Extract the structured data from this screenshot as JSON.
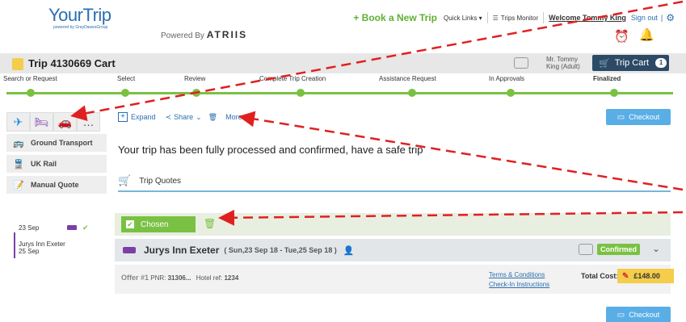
{
  "header": {
    "logo_main": "YourTrip",
    "logo_sub": "powered by GrayDawesGroup",
    "powered_by": "Powered By",
    "powered_brand": "ATRIIS",
    "book_new": "+ Book a New Trip",
    "quick_links": "Quick Links ▾",
    "trips_monitor": "Trips Monitor",
    "welcome": "Welcome Tommy King",
    "sign_out": "Sign out",
    "sep": "|"
  },
  "trip_bar": {
    "title": "Trip 4130669 Cart",
    "traveller_line1": "Mr. Tommy",
    "traveller_line2": "King (Adult)",
    "cart_label": "Trip Cart",
    "cart_count": "1"
  },
  "steps": [
    {
      "label": "Search or Request"
    },
    {
      "label": "Select"
    },
    {
      "label": "Review"
    },
    {
      "label": "Complete Trip Creation"
    },
    {
      "label": "Assistance Request"
    },
    {
      "label": "In Approvals"
    },
    {
      "label": "Finalized"
    }
  ],
  "sidebar": {
    "items": [
      {
        "label": "Ground Transport"
      },
      {
        "label": "UK Rail"
      },
      {
        "label": "Manual Quote"
      }
    ],
    "mini_trip": {
      "start": "23 Sep",
      "hotel": "Jurys Inn Exeter",
      "end": "25 Sep"
    }
  },
  "main": {
    "tools": {
      "expand": "Expand",
      "share": "Share",
      "more": "More"
    },
    "checkout_label": "Checkout",
    "confirm_msg": "Your trip has been fully processed and confirmed, have a safe trip",
    "quotes_label": "Trip Quotes",
    "chosen_label": "Chosen",
    "hotel": {
      "name": "Jurys Inn Exeter",
      "dates": "( Sun,23 Sep 18 - Tue,25 Sep 18 )",
      "status": "Confirmed"
    },
    "offer": {
      "label": "Offer #1",
      "pnr_label": "PNR:",
      "pnr": "31306...",
      "hotel_ref_label": "Hotel ref:",
      "hotel_ref": "1234",
      "terms": "Terms & Conditions",
      "checkin": "Check-In Instructions",
      "total_label": "Total Cost:",
      "total": "£148.00"
    }
  },
  "colors": {
    "accent_green": "#7ac143",
    "brand_blue": "#2a6fb0",
    "hotel_purple": "#7b3fa8",
    "cart_navy": "#2c4a66",
    "annotation_red": "#e02020"
  }
}
